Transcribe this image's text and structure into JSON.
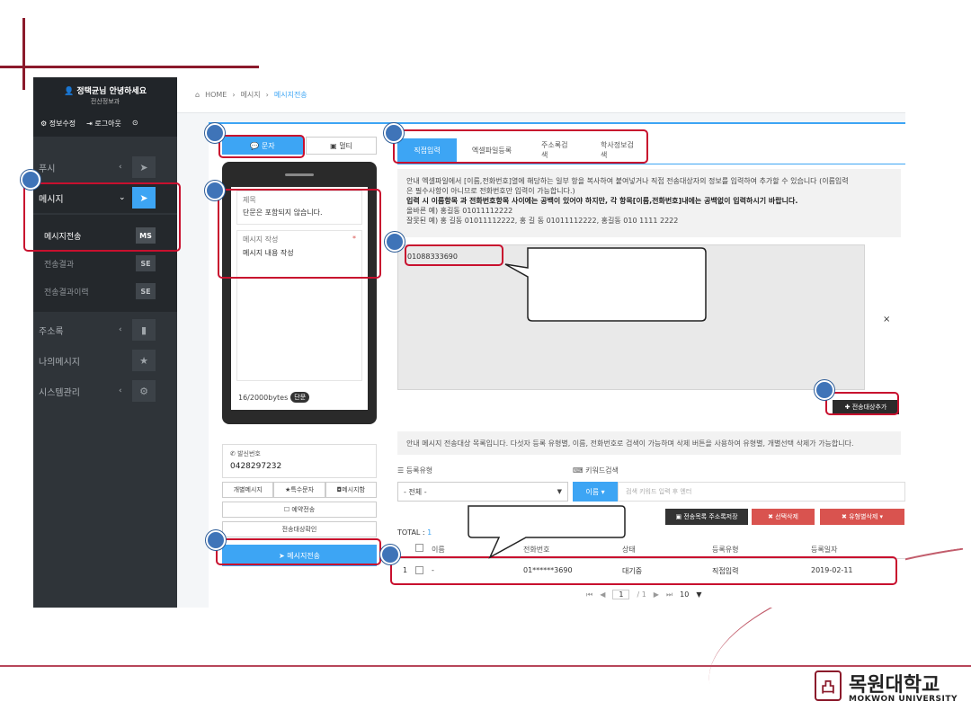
{
  "sidebar": {
    "greeting": "정택균님 안녕하세요",
    "dept": "전산정보과",
    "links": [
      "정보수정",
      "로그아웃"
    ],
    "items": [
      {
        "label": "푸시"
      },
      {
        "label": "메시지"
      },
      {
        "label": "주소록"
      },
      {
        "label": "나의메시지"
      },
      {
        "label": "시스템관리"
      }
    ],
    "subitems": [
      {
        "label": "메시지전송",
        "badge": "MS"
      },
      {
        "label": "전송결과",
        "badge": "SE"
      },
      {
        "label": "전송결과이력",
        "badge": "SE"
      }
    ]
  },
  "breadcrumb": {
    "home": "HOME",
    "section": "메시지",
    "current": "메시지전송"
  },
  "compose": {
    "tab_sms": "문자",
    "tab_mms": "멀티",
    "title_label": "제목",
    "title_value": "단문은 포함되지 않습니다.",
    "body_label": "메시지 작성",
    "body_value": "메시지 내용 작성",
    "byte_count": "16/2000bytes",
    "byte_type": "단문",
    "sender_label": "발신번호",
    "sender_value": "0428297232",
    "btn_individual": "개별메시지",
    "btn_special": "특수문자",
    "btn_template": "메시지함",
    "btn_reserve": "예약전송",
    "btn_check": "전송대상확인",
    "btn_send": "메시지전송"
  },
  "recipients": {
    "tabs": [
      "직접입력",
      "엑셀파일등록",
      "주소록검색",
      "학사정보검색"
    ],
    "notice_line1": "안내 엑셀파일에서 [이름,전화번호]열에 해당하는 일부 항을 복사하여 붙여넣거나 직접 전송대상자의 정보를 입력하여 추가할 수 있습니다 (이름입력",
    "notice_line2": "은 필수사항이 아니므로 전화번호만 입력이 가능합니다.)",
    "notice_line3": "입력 시 이름항목 과 전화번호항목 사이에는 공백이 있어야 하지만, 각 항목[이름,전화번호]내에는 공백없이 입력하시기 바랍니다.",
    "notice_line4": "올바른 예) 홍길동 01011112222",
    "notice_line5": "잘못된 예) 홍 길동 01011112222, 홍 길 동 01011112222, 홍길동 010 1111 2222",
    "input_value": "01088333690",
    "close": "×",
    "add_button": "전송대상추가",
    "notice2": "안내 메시지 전송대상 목록입니다. 다섯자 등록 유형별, 이름, 전화번호로 검색이 가능하며 삭제 버튼을 사용하여 유형별, 개별선택 삭제가 가능합니다.",
    "filter_type_label": "등록유형",
    "filter_type_value": "- 전체 -",
    "keyword_label": "키워드검색",
    "keyword_button": "이름",
    "keyword_placeholder": "검색 키워드 입력 후 엔터",
    "btn_save_address": "전송목록 주소록저장",
    "btn_delete_selected": "선택삭제",
    "btn_delete_type": "유형별삭제",
    "total_label": "TOTAL :",
    "total_value": "1",
    "columns": [
      "이름",
      "전화번호",
      "상태",
      "등록유형",
      "등록일자"
    ],
    "rows": [
      {
        "no": "1",
        "name": "-",
        "phone": "01******3690",
        "status": "대기중",
        "type": "직접입력",
        "date": "2019-02-11"
      }
    ],
    "pager_page": "1",
    "pager_total": "/ 1",
    "pager_size": "10"
  },
  "logo": {
    "name": "목원대학교",
    "english": "MOKWON UNIVERSITY"
  },
  "colors": {
    "accent": "#3da5f4",
    "highlight": "#c8102e",
    "marker": "#3f74b8",
    "sidebar": "#2f3439"
  }
}
